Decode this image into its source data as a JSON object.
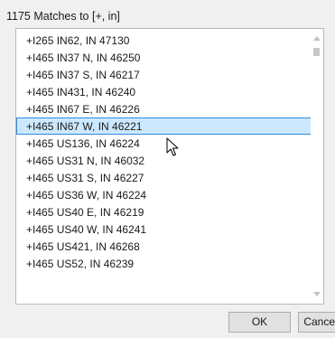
{
  "header": {
    "title": "1175 Matches to [+, in]"
  },
  "list": {
    "items": [
      {
        "label": "+I265 IN62, IN 47130"
      },
      {
        "label": "+I465 IN37 N, IN 46250"
      },
      {
        "label": "+I465 IN37 S, IN 46217"
      },
      {
        "label": "+I465 IN431, IN 46240"
      },
      {
        "label": "+I465 IN67 E, IN 46226"
      },
      {
        "label": "+I465 IN67 W, IN 46221"
      },
      {
        "label": "+I465 US136, IN 46224"
      },
      {
        "label": "+I465 US31 N, IN 46032"
      },
      {
        "label": "+I465 US31 S, IN 46227"
      },
      {
        "label": "+I465 US36 W, IN 46224"
      },
      {
        "label": "+I465 US40 E, IN 46219"
      },
      {
        "label": "+I465 US40 W, IN 46241"
      },
      {
        "label": "+I465 US421, IN 46268"
      },
      {
        "label": "+I465 US52, IN 46239"
      },
      {
        "label": ""
      }
    ],
    "selected_index": 5
  },
  "buttons": {
    "ok_label": "OK",
    "cancel_label": "Cancel"
  },
  "colors": {
    "selection_background": "#cce8ff",
    "selection_border": "#2f8bd6"
  },
  "icons": {
    "scroll_up": "chevron-up-icon",
    "scroll_down": "chevron-down-icon",
    "pointer": "mouse-pointer-icon"
  }
}
